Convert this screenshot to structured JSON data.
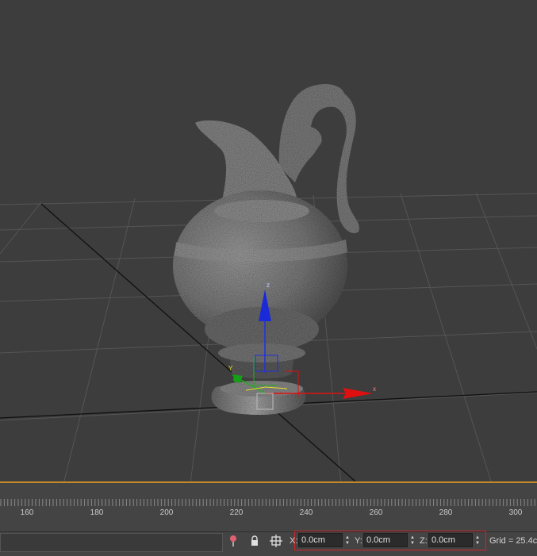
{
  "timeline": {
    "ruler_labels": [
      "160",
      "180",
      "200",
      "220",
      "240",
      "260",
      "280",
      "300"
    ]
  },
  "statusbar": {
    "x_label": "X:",
    "y_label": "Y:",
    "z_label": "Z:",
    "x_value": "0.0cm",
    "y_value": "0.0cm",
    "z_value": "0.0cm",
    "grid_text": "Grid = 25.4c"
  },
  "gizmo": {
    "z_label": "z",
    "y_label": "Y",
    "x_label": "x"
  },
  "colors": {
    "accent_orange": "#c18a2a",
    "highlight_red": "#d0262b",
    "axis_x": "#e01010",
    "axis_y": "#20b020",
    "axis_z": "#1a2ad8"
  },
  "icons": [
    "pin-icon",
    "lock-icon",
    "selection-lock-icon",
    "spinner-arrows-icon"
  ]
}
